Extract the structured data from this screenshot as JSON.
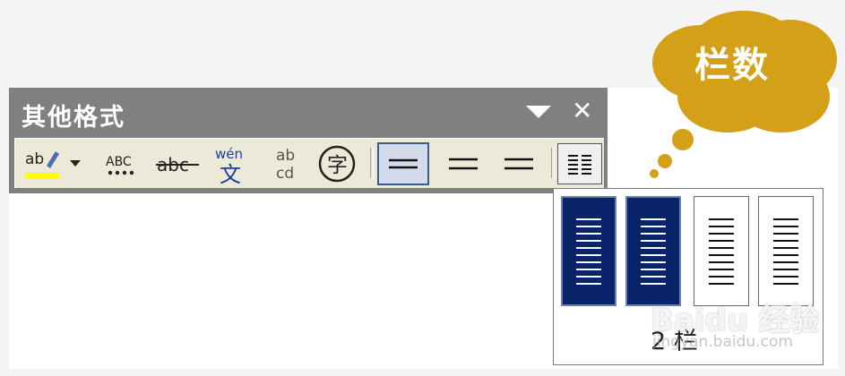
{
  "toolbar": {
    "title": "其他格式",
    "buttons": [
      {
        "name": "highlight",
        "label": "ab"
      },
      {
        "name": "spell-check",
        "label": "ABC"
      },
      {
        "name": "strikethrough",
        "label": "abc"
      },
      {
        "name": "phonetic-guide",
        "pinyin": "wén",
        "char": "文"
      },
      {
        "name": "combine-chars",
        "top": "ab",
        "bottom": "cd"
      },
      {
        "name": "enclose-char",
        "label": "字"
      }
    ]
  },
  "columns_popup": {
    "selected_label": "2 栏",
    "options": [
      {
        "index": 1,
        "selected": true
      },
      {
        "index": 2,
        "selected": true
      },
      {
        "index": 3,
        "selected": false
      },
      {
        "index": 4,
        "selected": false
      }
    ]
  },
  "callout": {
    "text": "栏数"
  },
  "watermark": {
    "brand": "Baidu 经验",
    "url": "jingyan.baidu.com"
  },
  "colors": {
    "toolbar_title_bg": "#808080",
    "toolbar_bg": "#ece9d8",
    "selection_blue": "#0a246a",
    "callout_gold": "#d4a017",
    "highlight_yellow": "#ffff00"
  }
}
